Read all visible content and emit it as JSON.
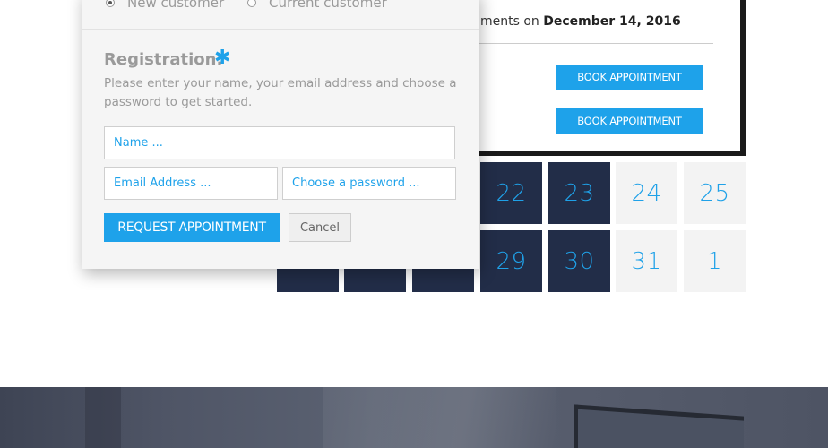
{
  "calendar": {
    "row1": [
      {
        "day": "22",
        "style": "dark"
      },
      {
        "day": "23",
        "style": "dark"
      },
      {
        "day": "24",
        "style": "light"
      },
      {
        "day": "25",
        "style": "light"
      }
    ],
    "row2": [
      {
        "day": "",
        "style": "dark"
      },
      {
        "day": "",
        "style": "dark"
      },
      {
        "day": "",
        "style": "dark"
      },
      {
        "day": "29",
        "style": "dark"
      },
      {
        "day": "30",
        "style": "dark"
      },
      {
        "day": "31",
        "style": "light"
      },
      {
        "day": "1",
        "style": "light"
      }
    ]
  },
  "booking": {
    "text_prefix": "ments on",
    "date": "December 14, 2016",
    "button1": "BOOK APPOINTMENT",
    "button2": "BOOK APPOINTMENT"
  },
  "popup": {
    "radio_new": "New customer",
    "radio_current": "Current customer",
    "title": "Registration:",
    "asterisk": "✱",
    "description": "Please enter your name, your email address and choose a password to get started.",
    "name_placeholder": "Name ...",
    "email_placeholder": "Email Address ...",
    "password_placeholder": "Choose a password ...",
    "request_button": "REQUEST APPOINTMENT",
    "cancel_button": "Cancel"
  },
  "colors": {
    "accent": "#1ea2ea",
    "dark_cell": "#222d48",
    "light_cell": "#f3f3f3"
  }
}
